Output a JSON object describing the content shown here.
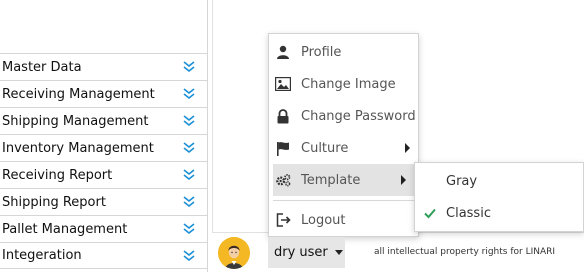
{
  "sidebar": {
    "items": [
      {
        "label": "Master Data",
        "icon": "double-chevron-down-icon"
      },
      {
        "label": "Receiving Management",
        "icon": "double-chevron-down-icon"
      },
      {
        "label": "Shipping Management",
        "icon": "double-chevron-down-icon"
      },
      {
        "label": "Inventory Management",
        "icon": "double-chevron-down-icon"
      },
      {
        "label": "Receiving Report",
        "icon": "double-chevron-down-icon"
      },
      {
        "label": "Shipping Report",
        "icon": "double-chevron-down-icon"
      },
      {
        "label": "Pallet Management",
        "icon": "double-chevron-down-icon"
      },
      {
        "label": "Integeration",
        "icon": "double-chevron-down-icon"
      }
    ]
  },
  "user_menu": {
    "profile": "Profile",
    "change_image": "Change Image",
    "change_password": "Change Password",
    "culture": "Culture",
    "template": "Template",
    "logout": "Logout"
  },
  "template_submenu": {
    "gray": "Gray",
    "classic": "Classic",
    "selected": "Classic"
  },
  "footer": {
    "username": "dry user",
    "copyright": "all intellectual property rights for LINARI"
  },
  "colors": {
    "accent_chevron": "#1a8fd6",
    "check": "#2e9e5b",
    "avatar_bg": "#f3b824",
    "active_menu_bg": "#e3e3e3"
  }
}
